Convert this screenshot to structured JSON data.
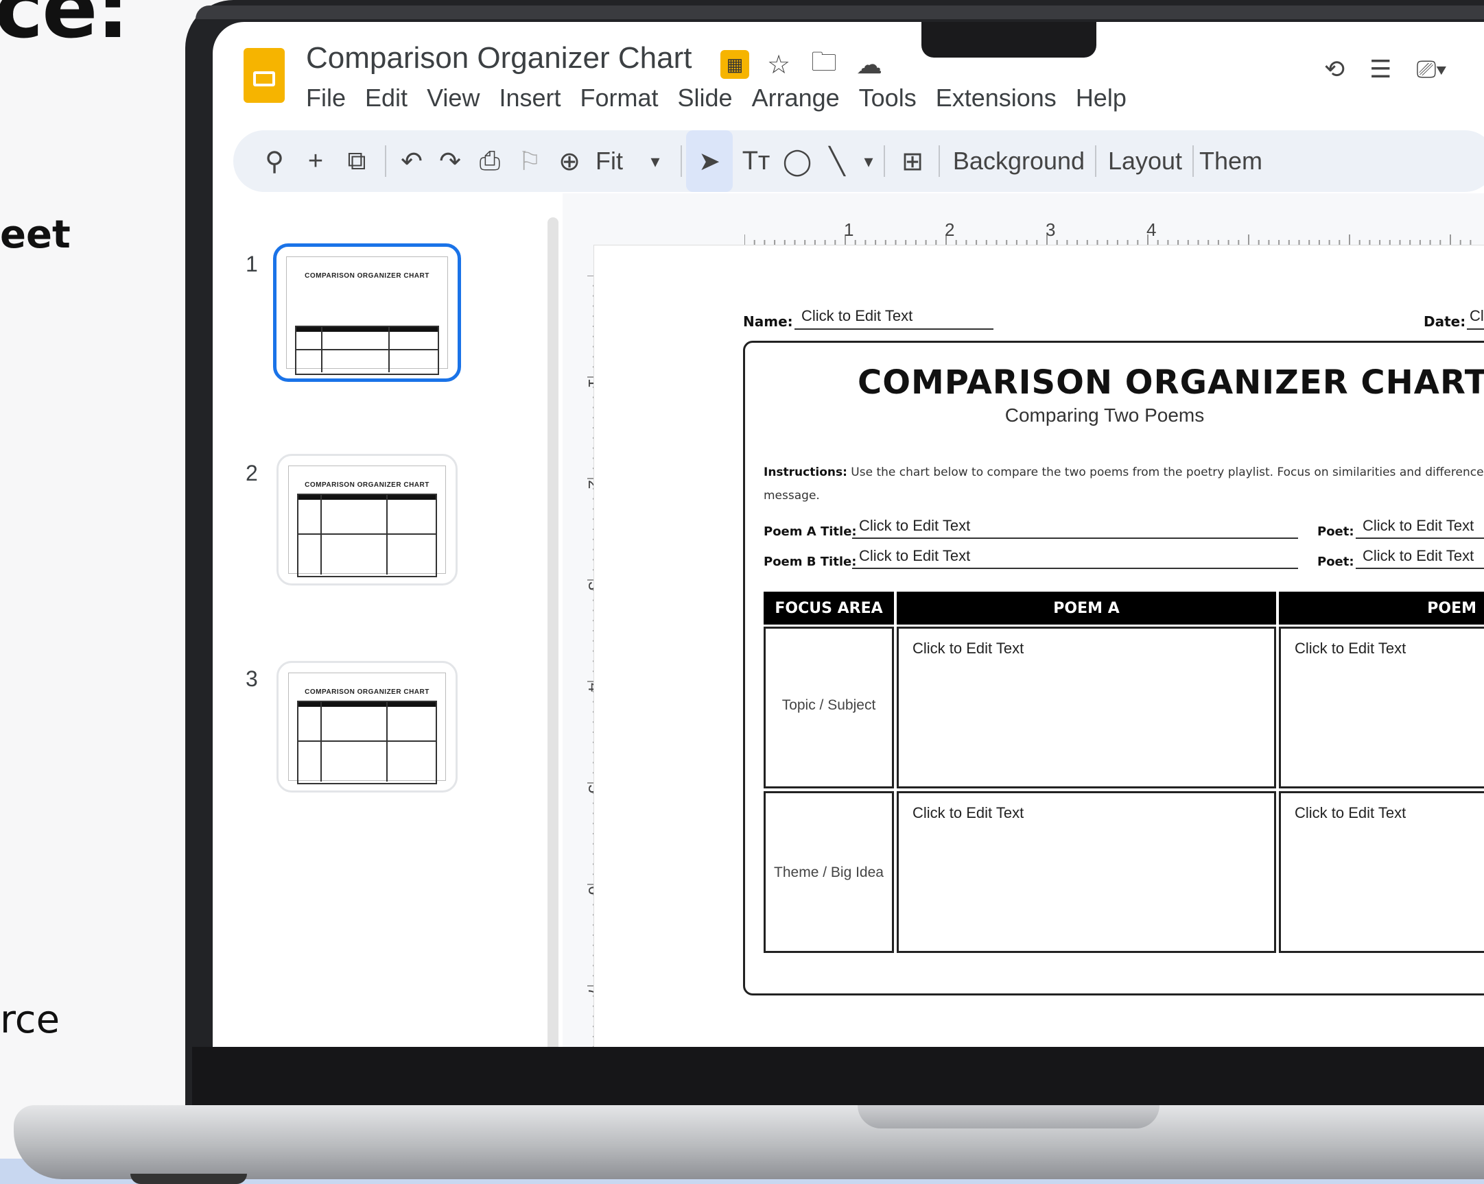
{
  "promo": {
    "top_fragment": "ce:",
    "middle_fragment": "eet",
    "bottom_fragment": "rce"
  },
  "doc": {
    "title": "Comparison Organizer Chart"
  },
  "title_icons": [
    "move-to-folder-icon",
    "star-icon",
    "folder-icon",
    "cloud-status-icon"
  ],
  "menu": [
    "File",
    "Edit",
    "View",
    "Insert",
    "Format",
    "Slide",
    "Arrange",
    "Tools",
    "Extensions",
    "Help"
  ],
  "right_icons": [
    "history-icon",
    "comments-icon",
    "camera-icon"
  ],
  "toolbar": {
    "zoom_label": "Fit",
    "background_label": "Background",
    "layout_label": "Layout",
    "theme_label": "Them"
  },
  "ruler": {
    "top": [
      "1",
      "2",
      "3",
      "4"
    ],
    "left": [
      "1",
      "2",
      "3",
      "4",
      "5",
      "6",
      "7"
    ]
  },
  "slides": [
    {
      "num": "1",
      "thumb_title": "COMPARISON ORGANIZER CHART"
    },
    {
      "num": "2",
      "thumb_title": "COMPARISON ORGANIZER CHART"
    },
    {
      "num": "3",
      "thumb_title": "COMPARISON ORGANIZER CHART"
    }
  ],
  "slide": {
    "name_label": "Name:",
    "name_value": "Click to Edit Text",
    "date_label": "Date:",
    "date_value": "Cl",
    "title": "COMPARISON ORGANIZER CHART",
    "subtitle": "Comparing Two Poems",
    "instructions_label": "Instructions:",
    "instructions_text": "Use the chart below to compare the two poems from the poetry playlist. Focus on similarities and differences",
    "instructions_cont": "message.",
    "poem_a_title_label": "Poem A Title:",
    "poem_a_title_value": "Click to Edit Text",
    "poem_b_title_label": "Poem B Title:",
    "poem_b_title_value": "Click to Edit Text",
    "poet_label": "Poet:",
    "poet_a_value": "Click to Edit Text",
    "poet_b_value": "Click to Edit Text",
    "headers": [
      "FOCUS AREA",
      "POEM A",
      "POEM"
    ],
    "rows": [
      {
        "focus": "Topic / Subject",
        "a": "Click to Edit Text",
        "b": "Click to Edit Text"
      },
      {
        "focus": "Theme / Big Idea",
        "a": "Click to Edit Text",
        "b": "Click to Edit Text"
      }
    ]
  }
}
